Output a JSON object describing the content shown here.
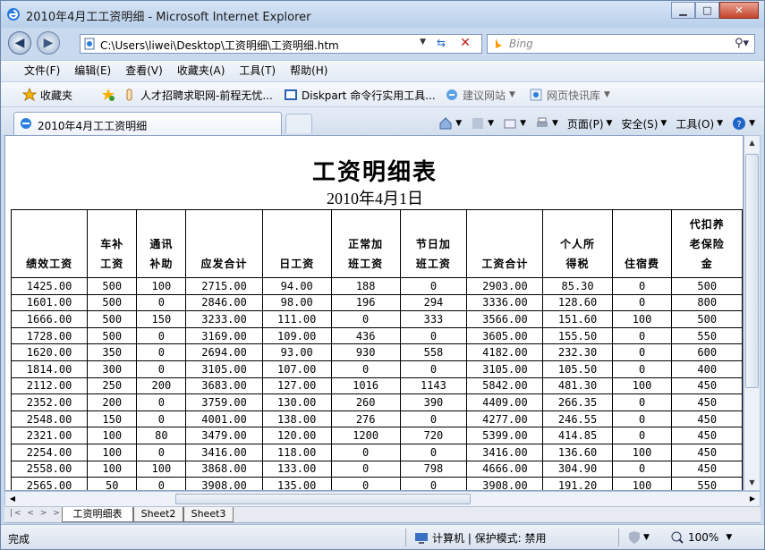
{
  "window": {
    "title": "2010年4月工工资明细 - Microsoft Internet Explorer",
    "minimize": "▁",
    "maximize": "□",
    "close": "✕"
  },
  "address": {
    "url": "C:\\Users\\liwei\\Desktop\\工资明细\\工资明细.htm",
    "search_placeholder": "Bing"
  },
  "menu": [
    "文件(F)",
    "编辑(E)",
    "查看(V)",
    "收藏夹(A)",
    "工具(T)",
    "帮助(H)"
  ],
  "favorites": {
    "label": "收藏夹",
    "links": [
      "人才招聘求职网-前程无忧...",
      "Diskpart 命令行实用工具...",
      "建议网站",
      "网页快讯库"
    ]
  },
  "tab": {
    "title": "2010年4月工工资明细"
  },
  "commands": [
    "页面(P)",
    "安全(S)",
    "工具(O)"
  ],
  "sheet": {
    "title": "工资明细表",
    "date": "2010年4月1日",
    "headers": [
      "绩效工资",
      "车补\n工资",
      "通讯\n补助",
      "应发合计",
      "日工资",
      "正常加\n班工资",
      "节日加\n班工资",
      "工资合计",
      "个人所\n得税",
      "住宿费",
      "代扣养\n老保险\n金"
    ],
    "rows": [
      [
        "1425.00",
        "500",
        "100",
        "2715.00",
        "94.00",
        "188",
        "0",
        "2903.00",
        "85.30",
        "0",
        "500"
      ],
      [
        "1601.00",
        "500",
        "0",
        "2846.00",
        "98.00",
        "196",
        "294",
        "3336.00",
        "128.60",
        "0",
        "800"
      ],
      [
        "1666.00",
        "500",
        "150",
        "3233.00",
        "111.00",
        "0",
        "333",
        "3566.00",
        "151.60",
        "100",
        "500"
      ],
      [
        "1728.00",
        "500",
        "0",
        "3169.00",
        "109.00",
        "436",
        "0",
        "3605.00",
        "155.50",
        "0",
        "550"
      ],
      [
        "1620.00",
        "350",
        "0",
        "2694.00",
        "93.00",
        "930",
        "558",
        "4182.00",
        "232.30",
        "0",
        "600"
      ],
      [
        "1814.00",
        "300",
        "0",
        "3105.00",
        "107.00",
        "0",
        "0",
        "3105.00",
        "105.50",
        "0",
        "400"
      ],
      [
        "2112.00",
        "250",
        "200",
        "3683.00",
        "127.00",
        "1016",
        "1143",
        "5842.00",
        "481.30",
        "100",
        "450"
      ],
      [
        "2352.00",
        "200",
        "0",
        "3759.00",
        "130.00",
        "260",
        "390",
        "4409.00",
        "266.35",
        "0",
        "450"
      ],
      [
        "2548.00",
        "150",
        "0",
        "4001.00",
        "138.00",
        "276",
        "0",
        "4277.00",
        "246.55",
        "0",
        "450"
      ],
      [
        "2321.00",
        "100",
        "80",
        "3479.00",
        "120.00",
        "1200",
        "720",
        "5399.00",
        "414.85",
        "0",
        "450"
      ],
      [
        "2254.00",
        "100",
        "0",
        "3416.00",
        "118.00",
        "0",
        "0",
        "3416.00",
        "136.60",
        "100",
        "450"
      ],
      [
        "2558.00",
        "100",
        "100",
        "3868.00",
        "133.00",
        "0",
        "798",
        "4666.00",
        "304.90",
        "0",
        "450"
      ],
      [
        "2565.00",
        "50",
        "0",
        "3908.00",
        "135.00",
        "0",
        "0",
        "3908.00",
        "191.20",
        "100",
        "550"
      ]
    ]
  },
  "sheet_tabs": [
    "工资明细表",
    "Sheet2",
    "Sheet3"
  ],
  "status": {
    "left": "完成",
    "zone": "计算机 | 保护模式: 禁用",
    "zoom": "100%"
  }
}
